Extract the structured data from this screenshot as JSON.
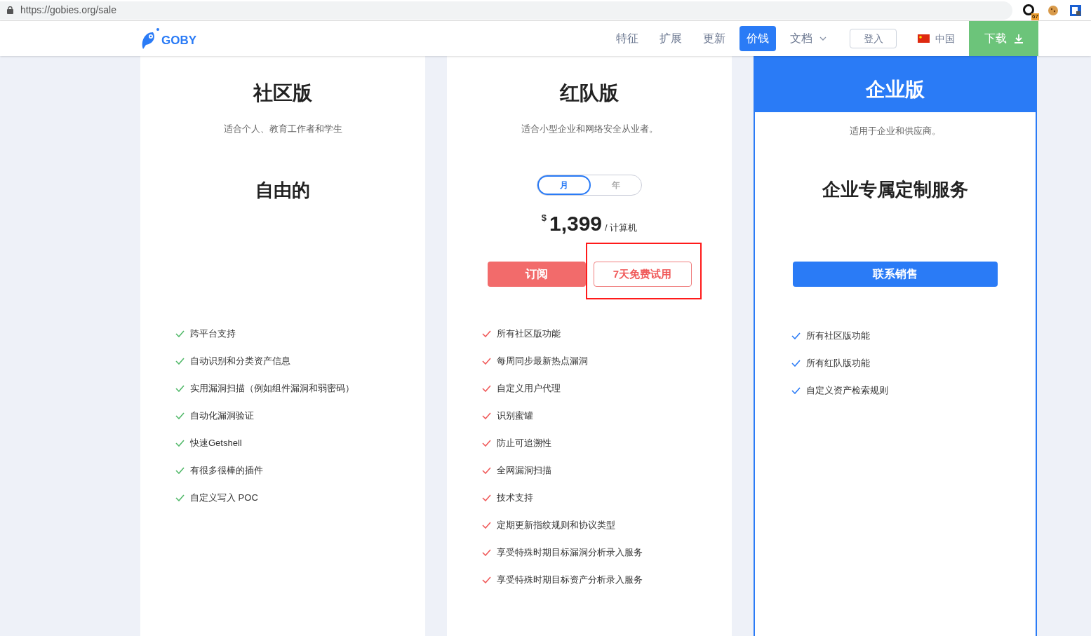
{
  "browser": {
    "url": "https://gobies.org/sale",
    "extension_badge": "67"
  },
  "nav": {
    "logo": "GOBY",
    "items": [
      {
        "label": "特征",
        "selected": false,
        "kind": "link"
      },
      {
        "label": "扩展",
        "selected": false,
        "kind": "link"
      },
      {
        "label": "更新",
        "selected": false,
        "kind": "link"
      },
      {
        "label": "价钱",
        "selected": true,
        "kind": "link"
      },
      {
        "label": "文档",
        "selected": false,
        "kind": "dropdown"
      }
    ],
    "login": "登入",
    "language": "中国",
    "download": "下载"
  },
  "plans": [
    {
      "kind": "community",
      "color": "#52b96a",
      "title": "社区版",
      "subtitle": "适合个人、教育工作者和学生",
      "headline": "自由的",
      "features": [
        "跨平台支持",
        "自动识别和分类资产信息",
        "实用漏洞扫描（例如组件漏洞和弱密码）",
        "自动化漏洞验证",
        "快速Getshell",
        "有很多很棒的插件",
        "自定义写入 POC"
      ]
    },
    {
      "kind": "team",
      "color": "#f05a5a",
      "title": "红队版",
      "subtitle": "适合小型企业和网络安全从业者。",
      "toggle": [
        {
          "label": "月",
          "selected": true
        },
        {
          "label": "年",
          "selected": false
        }
      ],
      "price": {
        "currency": "$",
        "amount": "1,399",
        "unit": "/ 计算机"
      },
      "buttons": [
        {
          "label": "订阅",
          "kind": "primary",
          "highlighted": false
        },
        {
          "label": "7天免费试用",
          "kind": "outline",
          "highlighted": true
        }
      ],
      "features": [
        "所有社区版功能",
        "每周同步最新热点漏洞",
        "自定义用户代理",
        "识别蜜罐",
        "防止可追溯性",
        "全网漏洞扫描",
        "技术支持",
        "定期更新指纹规则和协议类型",
        "享受特殊时期目标漏洞分析录入服务",
        "享受特殊时期目标资产分析录入服务"
      ]
    },
    {
      "kind": "enterprise",
      "color": "#2a7bf6",
      "title": "企业版",
      "subtitle": "适用于企业和供应商。",
      "headline": "企业专属定制服务",
      "buttons": [
        {
          "label": "联系销售",
          "kind": "primary",
          "highlighted": false
        }
      ],
      "features": [
        "所有社区版功能",
        "所有红队版功能",
        "自定义资产检索规则"
      ]
    }
  ]
}
